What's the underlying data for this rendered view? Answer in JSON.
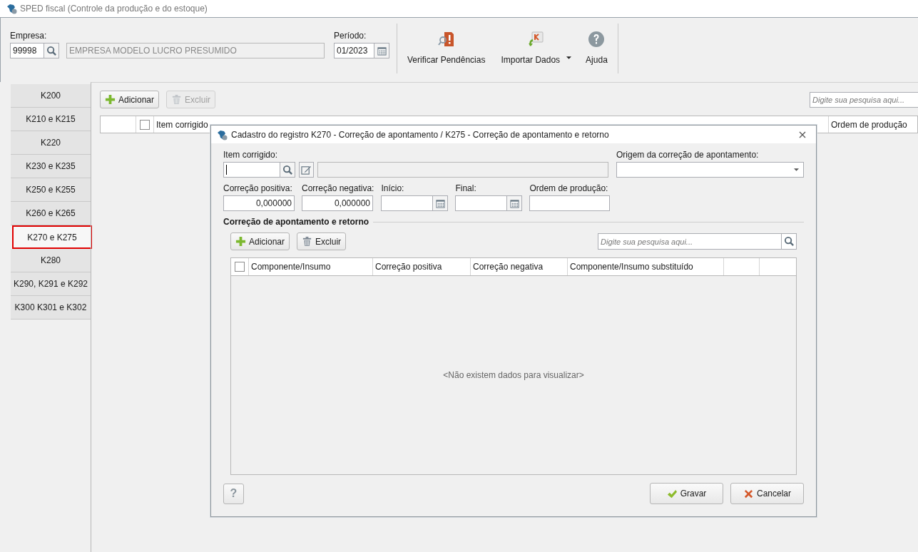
{
  "window": {
    "title": "SPED fiscal (Controle da produção e do estoque)"
  },
  "header": {
    "empresa": {
      "label": "Empresa:",
      "code": "99998",
      "name": "EMPRESA MODELO LUCRO PRESUMIDO"
    },
    "periodo": {
      "label": "Período:",
      "value": "01/2023"
    }
  },
  "toolbar": [
    {
      "label": "Verificar Pendências",
      "kind": "verify"
    },
    {
      "label": "Importar Dados",
      "kind": "import"
    },
    {
      "label": "Ajuda",
      "kind": "help"
    }
  ],
  "sidebar": {
    "items": [
      {
        "label": "K200",
        "selected": false
      },
      {
        "label": "K210 e K215",
        "selected": false
      },
      {
        "label": "K220",
        "selected": false
      },
      {
        "label": "K230 e K235",
        "selected": false
      },
      {
        "label": "K250 e K255",
        "selected": false
      },
      {
        "label": "K260 e K265",
        "selected": false
      },
      {
        "label": "K270 e K275",
        "selected": true
      },
      {
        "label": "K280",
        "selected": false
      },
      {
        "label": "K290, K291 e K292",
        "selected": false
      },
      {
        "label": "K300 K301 e K302",
        "selected": false
      }
    ]
  },
  "main": {
    "buttons": [
      {
        "label": "Adicionar",
        "kind": "add",
        "disabled": false
      },
      {
        "label": "Excluir",
        "kind": "delete",
        "disabled": true
      }
    ],
    "search": {
      "placeholder": "Digite sua pesquisa aqui..."
    },
    "table": {
      "select_all_checked": false,
      "columns": [
        "Item corrigido",
        "Ordem de produção"
      ]
    }
  },
  "dialog": {
    "title": "Cadastro do registro K270 - Correção de apontamento / K275 - Correção de apontamento e retorno",
    "item_label": "Item corrigido:",
    "origem_label": "Origem da correção de apontamento:",
    "fields": [
      {
        "label": "Correção positiva:",
        "value": "0,000000",
        "kind": "number"
      },
      {
        "label": "Correção negativa:",
        "value": "0,000000",
        "kind": "number"
      },
      {
        "label": "Início:",
        "kind": "date"
      },
      {
        "label": "Final:",
        "kind": "date"
      },
      {
        "label": "Ordem de produção:",
        "kind": "text"
      }
    ],
    "section": "Correção de apontamento e retorno",
    "buttons": [
      {
        "label": "Adicionar",
        "kind": "add",
        "disabled": false
      },
      {
        "label": "Excluir",
        "kind": "delete",
        "disabled": false
      }
    ],
    "search": {
      "placeholder": "Digite sua pesquisa aqui..."
    },
    "table": {
      "select_all_checked": false,
      "columns": [
        "Componente/Insumo",
        "Correção positiva",
        "Correção negativa",
        "Componente/Insumo substituído"
      ],
      "empty_message": "<Não existem dados para visualizar>"
    },
    "help_button": "?",
    "footer_buttons": [
      {
        "label": "Gravar",
        "kind": "save"
      },
      {
        "label": "Cancelar",
        "kind": "cancel"
      }
    ]
  }
}
